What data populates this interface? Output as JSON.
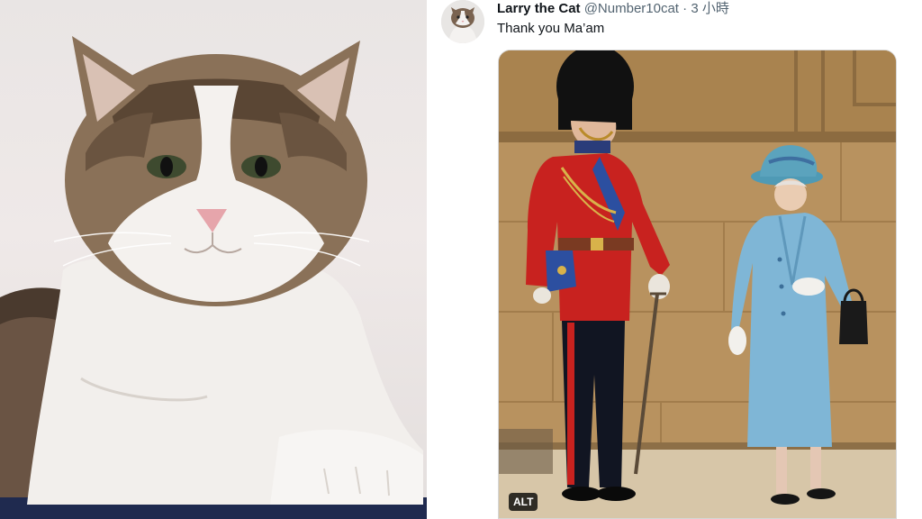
{
  "left_photo": {
    "icon": "cat-photo"
  },
  "tweet": {
    "display_name": "Larry the Cat",
    "handle": "@Number10cat",
    "separator": "·",
    "time": "3 小時",
    "text": "Thank you Ma’am",
    "avatar_icon": "cat-avatar",
    "media": {
      "icon": "royal-guard-and-queen-photo",
      "alt_badge": "ALT"
    }
  },
  "colors": {
    "name": "#0f1419",
    "secondary": "#536471",
    "alt_badge_bg": "#000000",
    "coat_red": "#c8221f",
    "queen_blue": "#7fb6d6",
    "wall_tan": "#b58e5c"
  }
}
